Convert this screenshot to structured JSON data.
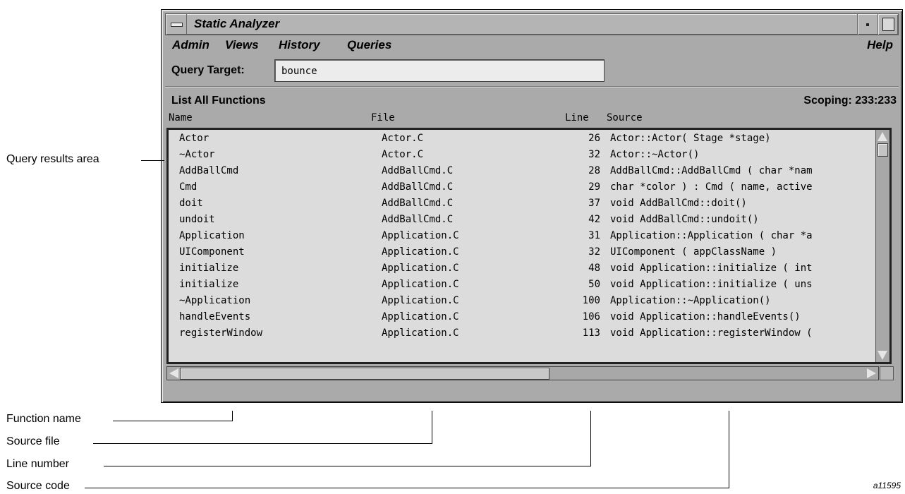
{
  "window": {
    "title": "Static Analyzer"
  },
  "menus": [
    "Admin",
    "Views",
    "History",
    "Queries",
    "Help"
  ],
  "query": {
    "label": "Query Target:",
    "value": "bounce"
  },
  "list": {
    "title": "List All Functions",
    "scoping": "Scoping: 233:233"
  },
  "columns": [
    "Name",
    "File",
    "Line",
    "Source"
  ],
  "rows": [
    [
      "Actor",
      "Actor.C",
      "26",
      "Actor::Actor( Stage *stage)"
    ],
    [
      "~Actor",
      "Actor.C",
      "32",
      "Actor::~Actor()"
    ],
    [
      "AddBallCmd",
      "AddBallCmd.C",
      "28",
      "AddBallCmd::AddBallCmd ( char *nam"
    ],
    [
      "Cmd",
      "AddBallCmd.C",
      "29",
      "char *color ) : Cmd ( name, active"
    ],
    [
      "doit",
      "AddBallCmd.C",
      "37",
      "void AddBallCmd::doit()"
    ],
    [
      "undoit",
      "AddBallCmd.C",
      "42",
      "void AddBallCmd::undoit()"
    ],
    [
      "Application",
      "Application.C",
      "31",
      "Application::Application ( char *a"
    ],
    [
      "UIComponent",
      "Application.C",
      "32",
      "UIComponent ( appClassName )"
    ],
    [
      "initialize",
      "Application.C",
      "48",
      "void Application::initialize ( int"
    ],
    [
      "initialize",
      "Application.C",
      "50",
      "void Application::initialize ( uns"
    ],
    [
      "~Application",
      "Application.C",
      "100",
      "Application::~Application()"
    ],
    [
      "handleEvents",
      "Application.C",
      "106",
      "void Application::handleEvents()"
    ],
    [
      "registerWindow",
      "Application.C",
      "113",
      "void Application::registerWindow ("
    ]
  ],
  "callouts": {
    "results_area": "Query results area",
    "function_name": "Function name",
    "source_file": "Source file",
    "line_number": "Line number",
    "source_code": "Source code"
  },
  "figure_id": "a11595"
}
